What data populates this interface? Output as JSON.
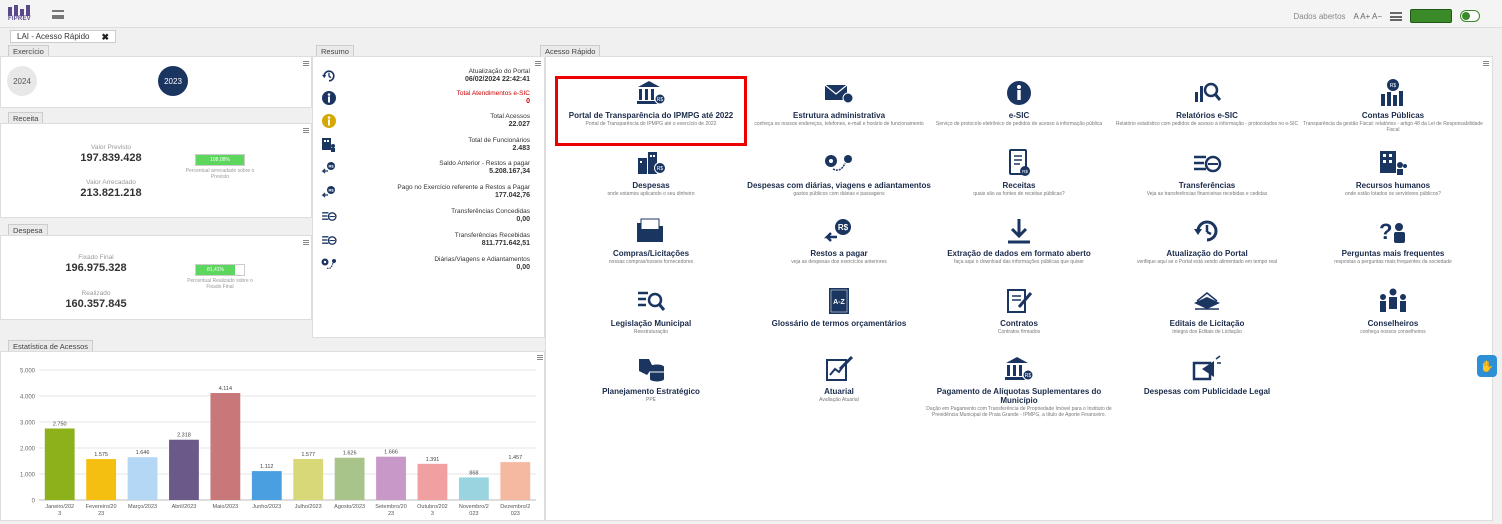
{
  "brand": {
    "logo_text": "FIPREV"
  },
  "top_right": {
    "dados_abertos": "Dados abertos",
    "font_controls": "A A+ A−",
    "badge": "",
    "toggle_label": ""
  },
  "tab": {
    "label": "LAI - Acesso Rápido",
    "close": "✖"
  },
  "exercicio": {
    "title": "Exercício",
    "years": [
      "2024",
      "2023"
    ],
    "selected": "2023"
  },
  "receita": {
    "title": "Receita",
    "previsto_label": "Valor Previsto",
    "previsto_value": "197.839.428",
    "arrecadado_label": "Valor Arrecadado",
    "arrecadado_value": "213.821.218",
    "percent_text": "108,08%",
    "percent_fill": 1.0,
    "caption": "Percentual arrecadado sobre o Previsto"
  },
  "despesa": {
    "title": "Despesa",
    "fixado_label": "Fixado Final",
    "fixado_value": "196.975.328",
    "realizado_label": "Realizado",
    "realizado_value": "160.357.845",
    "percent_text": "81,41%",
    "percent_fill": 0.8141,
    "caption": "Percentual Realizado sobre o Fixado Final"
  },
  "resumo": {
    "title": "Resumo",
    "rows": [
      {
        "icon": "clock-refresh-icon",
        "label": "Atualização do Portal",
        "value": "06/02/2024 22:42:41",
        "red": false
      },
      {
        "icon": "info-icon",
        "label": "Total Atendimentos e-SIC",
        "value": "0",
        "red": true
      },
      {
        "icon": "info-gold-icon",
        "label": "Total Acessos",
        "value": "22.027",
        "red": false
      },
      {
        "icon": "staff-icon",
        "label": "Total de Funcionários",
        "value": "2.483",
        "red": false
      },
      {
        "icon": "money-back-icon",
        "label": "Saldo Anterior - Restos a pagar",
        "value": "5.208.167,34",
        "red": false
      },
      {
        "icon": "money-back-icon",
        "label": "Pago no Exercício referente a Restos a Pagar",
        "value": "177.042,76",
        "red": false
      },
      {
        "icon": "transfer-icon",
        "label": "Transferências Concedidas",
        "value": "0,00",
        "red": false
      },
      {
        "icon": "transfer-icon",
        "label": "Transferências Recebidas",
        "value": "811.771.642,51",
        "red": false
      },
      {
        "icon": "travel-icon",
        "label": "Diárias/Viagens e Adiantamentos",
        "value": "0,00",
        "red": false
      }
    ]
  },
  "acesso_rapido": {
    "title": "Acesso Rápido",
    "items": [
      {
        "icon": "bank-icon",
        "title": "Portal de Transparência do IPMPG até 2022",
        "desc": "Portal de Transparência do IPMPG até o exercício de 2022"
      },
      {
        "icon": "mail-icon",
        "title": "Estrutura administrativa",
        "desc": "conheça os nossos endereços, telefones, e-mail e horário de funcionamento"
      },
      {
        "icon": "info-circle-icon",
        "title": "e-SIC",
        "desc": "Serviço de protocolo eletrônico de pedidos de acesso à informação pública"
      },
      {
        "icon": "report-search-icon",
        "title": "Relatórios e-SIC",
        "desc": "Relatório estatístico com pedidos de acesso à informação - protocolados no e-SIC"
      },
      {
        "icon": "public-accounts-icon",
        "title": "Contas Públicas",
        "desc": "Transparência da gestão Fiscal: relatórios - artigo 48 da Lei de Responsabilidade Fiscal"
      },
      {
        "icon": "city-money-icon",
        "title": "Despesas",
        "desc": "onde estamos aplicando o seu dinheiro"
      },
      {
        "icon": "route-icon",
        "title": "Despesas com diárias, viagens e adiantamentos",
        "desc": "gastos públicos com diárias e passagens"
      },
      {
        "icon": "receipt-icon",
        "title": "Receitas",
        "desc": "quais são as fontes de receitas públicas?"
      },
      {
        "icon": "transfer-icon",
        "title": "Transferências",
        "desc": "Veja as transferências financeiras recebidas e cedidas"
      },
      {
        "icon": "hr-icon",
        "title": "Recursos humanos",
        "desc": "onde estão lotados os servidores públicos?"
      },
      {
        "icon": "folder-icon",
        "title": "Compras/Licitações",
        "desc": "nossas compras/nossos fornecedores"
      },
      {
        "icon": "money-back-icon",
        "title": "Restos a pagar",
        "desc": "veja as despesas dos exercícios anteriores"
      },
      {
        "icon": "download-icon",
        "title": "Extração de dados em formato aberto",
        "desc": "faça aqui o download das informações públicas que quiser"
      },
      {
        "icon": "clock-refresh-icon",
        "title": "Atualização do Portal",
        "desc": "verifique aqui se o Portal está sendo alimentado em tempo real"
      },
      {
        "icon": "faq-icon",
        "title": "Perguntas mais frequentes",
        "desc": "respostas a perguntas mais frequentes da sociedade"
      },
      {
        "icon": "law-search-icon",
        "title": "Legislação Municipal",
        "desc": "Reestruturação"
      },
      {
        "icon": "glossary-icon",
        "title": "Glossário de termos orçamentários",
        "desc": ""
      },
      {
        "icon": "contract-icon",
        "title": "Contratos",
        "desc": "Contratos firmados"
      },
      {
        "icon": "tender-icon",
        "title": "Editais de Licitação",
        "desc": "Integra dos Editais de Licitação"
      },
      {
        "icon": "council-icon",
        "title": "Conselheiros",
        "desc": "conheça nossos conselheiros"
      },
      {
        "icon": "strategy-icon",
        "title": "Planejamento Estratégico",
        "desc": "PPE"
      },
      {
        "icon": "actuarial-icon",
        "title": "Atuarial",
        "desc": "Avaliação Atuarial"
      },
      {
        "icon": "bank-icon",
        "title": "Pagamento de Alíquotas Suplementares do Município",
        "desc": "Dação em Pagamento com Transferência de Propriedade Imóvel para o Instituto de Previdência Municipal de Praia Grande - IPMPG, a título de Aporte Financeiro."
      },
      {
        "icon": "ads-icon",
        "title": "Despesas com Publicidade Legal",
        "desc": ""
      }
    ]
  },
  "chart_data": {
    "type": "bar",
    "title": "Estatística de Acessos",
    "categories": [
      "Janeiro/2023",
      "Fevereiro/2023",
      "Março/2023",
      "Abril/2023",
      "Maio/2023",
      "Junho/2023",
      "Julho/2023",
      "Agosto/2023",
      "Setembro/2023",
      "Outubro/2023",
      "Novembro/2023",
      "Dezembro/2023"
    ],
    "category_lines": [
      [
        "Janeiro/202",
        "3"
      ],
      [
        "Fevereiro/20",
        "23"
      ],
      [
        "Março/2023"
      ],
      [
        "Abril/2023"
      ],
      [
        "Maio/2023"
      ],
      [
        "Junho/2023"
      ],
      [
        "Julho/2023"
      ],
      [
        "Agosto/2023"
      ],
      [
        "Setembro/20",
        "23"
      ],
      [
        "Outubro/202",
        "3"
      ],
      [
        "Novembro/2",
        "023"
      ],
      [
        "Dezembro/2",
        "023"
      ]
    ],
    "values": [
      2750,
      1575,
      1646,
      2318,
      4114,
      1112,
      1577,
      1626,
      1666,
      1391,
      868,
      1457
    ],
    "value_labels": [
      "2.750",
      "1.575",
      "1.646",
      "2.318",
      "4.114",
      "1.112",
      "1.577",
      "1.626",
      "1.666",
      "1.391",
      "868",
      "1.457"
    ],
    "colors": [
      "#8db11b",
      "#f5bf11",
      "#b3d7f5",
      "#6a5a8a",
      "#c87878",
      "#4a9fe0",
      "#d8d878",
      "#a8c48a",
      "#c898c8",
      "#f0a0a0",
      "#9ad4e0",
      "#f5b8a0"
    ],
    "yticks": [
      "0",
      "1.000",
      "2.000",
      "3.000",
      "4.000",
      "5.000"
    ],
    "ylim": [
      0,
      5000
    ],
    "grid": true
  }
}
